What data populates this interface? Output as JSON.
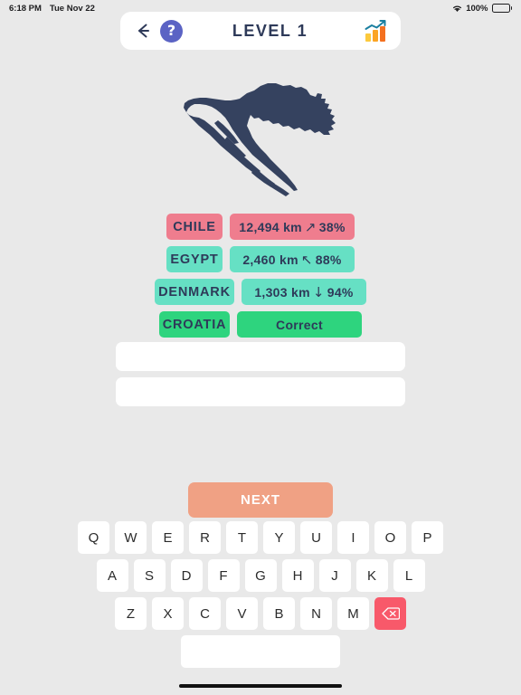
{
  "status_bar": {
    "time": "6:18 PM",
    "date": "Tue Nov 22",
    "battery_percent": "100%",
    "wifi_icon": "wifi-icon",
    "battery_icon": "battery-full-icon"
  },
  "header": {
    "back_icon": "back-arrow-icon",
    "help_icon": "question-mark-icon",
    "help_label": "?",
    "title": "LEVEL 1",
    "stats_icon": "bar-chart-icon"
  },
  "map": {
    "name": "croatia-map-silhouette",
    "fill_color": "#35425f"
  },
  "guesses": [
    {
      "country": "CHILE",
      "distance": "12,494 km",
      "arrow": "↗",
      "arrow_name": "arrow-northeast-icon",
      "percent": "38%",
      "country_color": "#ef7d8e",
      "info_color": "#ef7d8e",
      "country_width": 62,
      "info_width": 138
    },
    {
      "country": "EGYPT",
      "distance": "2,460 km",
      "arrow": "↖",
      "arrow_name": "arrow-northwest-icon",
      "percent": "88%",
      "country_color": "#66e0c4",
      "info_color": "#66e0c4",
      "country_width": 62,
      "info_width": 138
    },
    {
      "country": "DENMARK",
      "distance": "1,303 km",
      "arrow": "↓",
      "arrow_name": "arrow-down-icon",
      "percent": "94%",
      "country_color": "#66e0c4",
      "info_color": "#66e0c4",
      "country_width": 88,
      "info_width": 138
    },
    {
      "country": "CROATIA",
      "distance": "Correct",
      "arrow": "",
      "arrow_name": "none",
      "percent": "",
      "country_color": "#2ed47e",
      "info_color": "#2ed47e",
      "country_width": 78,
      "info_width": 138
    }
  ],
  "empty_rows": [
    {
      "value": "",
      "placeholder": ""
    },
    {
      "value": "",
      "placeholder": ""
    }
  ],
  "next_button": {
    "label": "NEXT",
    "color": "#f0a184"
  },
  "keyboard": {
    "row1": [
      "Q",
      "W",
      "E",
      "R",
      "T",
      "Y",
      "U",
      "I",
      "O",
      "P"
    ],
    "row2": [
      "A",
      "S",
      "D",
      "F",
      "G",
      "H",
      "J",
      "K",
      "L"
    ],
    "row3": [
      "Z",
      "X",
      "C",
      "V",
      "B",
      "N",
      "M"
    ],
    "backspace_icon": "backspace-delete-icon",
    "backspace_color": "#f8596a",
    "space_label": ""
  },
  "colors": {
    "background": "#e9e9e9",
    "navy": "#2e3a59",
    "map_navy": "#35425f",
    "help_purple": "#5b63c4",
    "pink": "#ef7d8e",
    "mint": "#66e0c4",
    "green": "#2ed47e",
    "orange": "#f0a184"
  }
}
